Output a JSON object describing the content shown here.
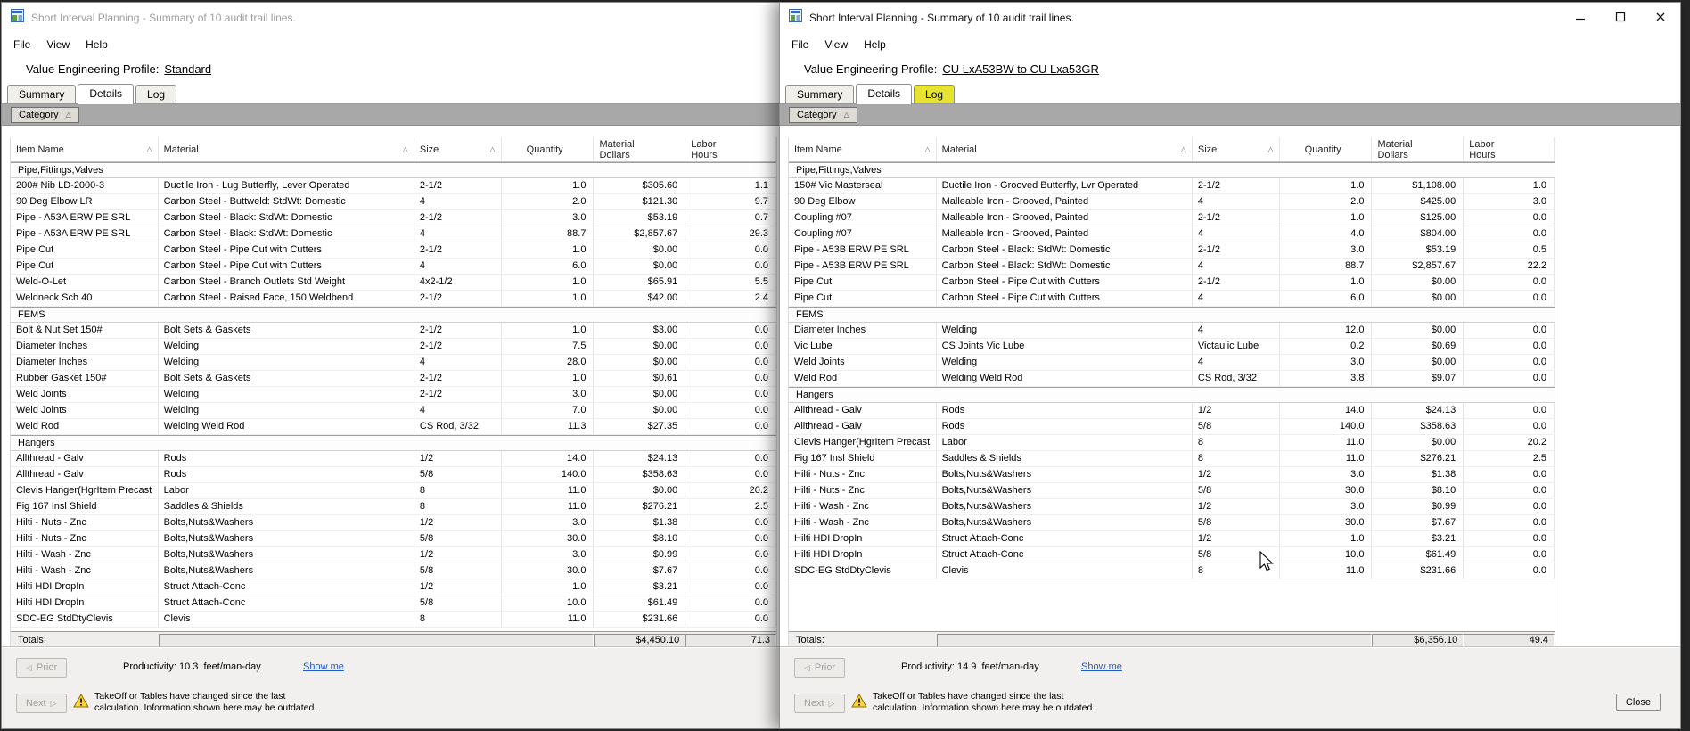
{
  "colors": {
    "log_tab_highlight": "#e6e332",
    "link_blue": "#2257c8",
    "warning_yellow": "#ffd23b"
  },
  "icons": {
    "sort_asc": "△",
    "prior_arrow": "◁",
    "next_arrow": "▷"
  },
  "columns": [
    {
      "label": "Item Name",
      "sortable": true
    },
    {
      "label": "Material",
      "sortable": true
    },
    {
      "label": "Size",
      "sortable": true
    },
    {
      "label": "Quantity",
      "sortable": false
    },
    {
      "label": "Material\nDollars",
      "sortable": false
    },
    {
      "label": "Labor\nHours",
      "sortable": false
    }
  ],
  "windows": [
    {
      "title": "Short Interval Planning - Summary of 10 audit trail lines.",
      "active": false,
      "menu": {
        "file": "File",
        "view": "View",
        "help": "Help"
      },
      "profile_label": "Value Engineering Profile:",
      "profile_value": "Standard",
      "tabs": {
        "summary": "Summary",
        "details": "Details",
        "log": "Log"
      },
      "group_by_label": "Category",
      "groups": [
        {
          "name": "Pipe,Fittings,Valves",
          "rows": [
            [
              "200# Nib LD-2000-3",
              "Ductile Iron - Lug Butterfly, Lever Operated",
              "2-1/2",
              "1.0",
              "$305.60",
              "1.1"
            ],
            [
              "90 Deg Elbow LR",
              "Carbon Steel - Buttweld: StdWt: Domestic",
              "4",
              "2.0",
              "$121.30",
              "9.7"
            ],
            [
              "Pipe - A53A ERW PE SRL",
              "Carbon Steel - Black: StdWt: Domestic",
              "2-1/2",
              "3.0",
              "$53.19",
              "0.7"
            ],
            [
              "Pipe - A53A ERW PE SRL",
              "Carbon Steel - Black: StdWt: Domestic",
              "4",
              "88.7",
              "$2,857.67",
              "29.3"
            ],
            [
              "Pipe Cut",
              "Carbon Steel - Pipe Cut with Cutters",
              "2-1/2",
              "1.0",
              "$0.00",
              "0.0"
            ],
            [
              "Pipe Cut",
              "Carbon Steel - Pipe Cut with Cutters",
              "4",
              "6.0",
              "$0.00",
              "0.0"
            ],
            [
              "Weld-O-Let",
              "Carbon Steel - Branch Outlets Std Weight",
              "4x2-1/2",
              "1.0",
              "$65.91",
              "5.5"
            ],
            [
              "Weldneck Sch 40",
              "Carbon Steel - Raised Face, 150 Weldbend",
              "2-1/2",
              "1.0",
              "$42.00",
              "2.4"
            ]
          ]
        },
        {
          "name": "FEMS",
          "rows": [
            [
              "Bolt & Nut Set 150#",
              "Bolt Sets & Gaskets",
              "2-1/2",
              "1.0",
              "$3.00",
              "0.0"
            ],
            [
              "Diameter Inches",
              "Welding",
              "2-1/2",
              "7.5",
              "$0.00",
              "0.0"
            ],
            [
              "Diameter Inches",
              "Welding",
              "4",
              "28.0",
              "$0.00",
              "0.0"
            ],
            [
              "Rubber Gasket 150#",
              "Bolt Sets & Gaskets",
              "2-1/2",
              "1.0",
              "$0.61",
              "0.0"
            ],
            [
              "Weld Joints",
              "Welding",
              "2-1/2",
              "3.0",
              "$0.00",
              "0.0"
            ],
            [
              "Weld Joints",
              "Welding",
              "4",
              "7.0",
              "$0.00",
              "0.0"
            ],
            [
              "Weld Rod",
              "Welding Weld Rod",
              "CS Rod, 3/32",
              "11.3",
              "$27.35",
              "0.0"
            ]
          ]
        },
        {
          "name": "Hangers",
          "rows": [
            [
              "Allthread - Galv",
              "Rods",
              "1/2",
              "14.0",
              "$24.13",
              "0.0"
            ],
            [
              "Allthread - Galv",
              "Rods",
              "5/8",
              "140.0",
              "$358.63",
              "0.0"
            ],
            [
              "Clevis Hanger(HgrItem Precast",
              "Labor",
              "8",
              "11.0",
              "$0.00",
              "20.2"
            ],
            [
              "Fig 167 Insl Shield",
              "Saddles & Shields",
              "8",
              "11.0",
              "$276.21",
              "2.5"
            ],
            [
              "Hilti - Nuts - Znc",
              "Bolts,Nuts&Washers",
              "1/2",
              "3.0",
              "$1.38",
              "0.0"
            ],
            [
              "Hilti - Nuts - Znc",
              "Bolts,Nuts&Washers",
              "5/8",
              "30.0",
              "$8.10",
              "0.0"
            ],
            [
              "Hilti - Wash - Znc",
              "Bolts,Nuts&Washers",
              "1/2",
              "3.0",
              "$0.99",
              "0.0"
            ],
            [
              "Hilti - Wash - Znc",
              "Bolts,Nuts&Washers",
              "5/8",
              "30.0",
              "$7.67",
              "0.0"
            ],
            [
              "Hilti HDI DropIn",
              "Struct Attach-Conc",
              "1/2",
              "1.0",
              "$3.21",
              "0.0"
            ],
            [
              "Hilti HDI DropIn",
              "Struct Attach-Conc",
              "5/8",
              "10.0",
              "$61.49",
              "0.0"
            ],
            [
              "SDC-EG StdDtyClevis",
              "Clevis",
              "8",
              "11.0",
              "$231.66",
              "0.0"
            ]
          ]
        }
      ],
      "totals": {
        "label": "Totals:",
        "material_dollars": "$4,450.10",
        "labor_hours": "71.3"
      },
      "footer": {
        "prior": "Prior",
        "next": "Next",
        "productivity": "Productivity: 10.3  feet/man-day",
        "show_me": "Show me",
        "warning_line1": "TakeOff or Tables have changed since the last",
        "warning_line2": "calculation. Information shown here may be outdated."
      }
    },
    {
      "title": "Short Interval Planning - Summary of 10 audit trail lines.",
      "active": true,
      "menu": {
        "file": "File",
        "view": "View",
        "help": "Help"
      },
      "profile_label": "Value Engineering Profile:",
      "profile_value": "CU LxA53BW to CU Lxa53GR",
      "tabs": {
        "summary": "Summary",
        "details": "Details",
        "log": "Log"
      },
      "group_by_label": "Category",
      "groups": [
        {
          "name": "Pipe,Fittings,Valves",
          "rows": [
            [
              "150# Vic Masterseal",
              "Ductile Iron - Grooved Butterfly, Lvr Operated",
              "2-1/2",
              "1.0",
              "$1,108.00",
              "1.0"
            ],
            [
              "90 Deg Elbow",
              "Malleable Iron - Grooved, Painted",
              "4",
              "2.0",
              "$425.00",
              "3.0"
            ],
            [
              "Coupling #07",
              "Malleable Iron - Grooved, Painted",
              "2-1/2",
              "1.0",
              "$125.00",
              "0.0"
            ],
            [
              "Coupling #07",
              "Malleable Iron - Grooved, Painted",
              "4",
              "4.0",
              "$804.00",
              "0.0"
            ],
            [
              "Pipe - A53B ERW PE SRL",
              "Carbon Steel - Black: StdWt: Domestic",
              "2-1/2",
              "3.0",
              "$53.19",
              "0.5"
            ],
            [
              "Pipe - A53B ERW PE SRL",
              "Carbon Steel - Black: StdWt: Domestic",
              "4",
              "88.7",
              "$2,857.67",
              "22.2"
            ],
            [
              "Pipe Cut",
              "Carbon Steel - Pipe Cut with Cutters",
              "2-1/2",
              "1.0",
              "$0.00",
              "0.0"
            ],
            [
              "Pipe Cut",
              "Carbon Steel - Pipe Cut with Cutters",
              "4",
              "6.0",
              "$0.00",
              "0.0"
            ]
          ]
        },
        {
          "name": "FEMS",
          "rows": [
            [
              "Diameter Inches",
              "Welding",
              "4",
              "12.0",
              "$0.00",
              "0.0"
            ],
            [
              "Vic Lube",
              "CS Joints Vic Lube",
              "Victaulic Lube",
              "0.2",
              "$0.69",
              "0.0"
            ],
            [
              "Weld Joints",
              "Welding",
              "4",
              "3.0",
              "$0.00",
              "0.0"
            ],
            [
              "Weld Rod",
              "Welding Weld Rod",
              "CS Rod, 3/32",
              "3.8",
              "$9.07",
              "0.0"
            ]
          ]
        },
        {
          "name": "Hangers",
          "rows": [
            [
              "Allthread - Galv",
              "Rods",
              "1/2",
              "14.0",
              "$24.13",
              "0.0"
            ],
            [
              "Allthread - Galv",
              "Rods",
              "5/8",
              "140.0",
              "$358.63",
              "0.0"
            ],
            [
              "Clevis Hanger(HgrItem Precast",
              "Labor",
              "8",
              "11.0",
              "$0.00",
              "20.2"
            ],
            [
              "Fig 167 Insl Shield",
              "Saddles & Shields",
              "8",
              "11.0",
              "$276.21",
              "2.5"
            ],
            [
              "Hilti - Nuts - Znc",
              "Bolts,Nuts&Washers",
              "1/2",
              "3.0",
              "$1.38",
              "0.0"
            ],
            [
              "Hilti - Nuts - Znc",
              "Bolts,Nuts&Washers",
              "5/8",
              "30.0",
              "$8.10",
              "0.0"
            ],
            [
              "Hilti - Wash - Znc",
              "Bolts,Nuts&Washers",
              "1/2",
              "3.0",
              "$0.99",
              "0.0"
            ],
            [
              "Hilti - Wash - Znc",
              "Bolts,Nuts&Washers",
              "5/8",
              "30.0",
              "$7.67",
              "0.0"
            ],
            [
              "Hilti HDI DropIn",
              "Struct Attach-Conc",
              "1/2",
              "1.0",
              "$3.21",
              "0.0"
            ],
            [
              "Hilti HDI DropIn",
              "Struct Attach-Conc",
              "5/8",
              "10.0",
              "$61.49",
              "0.0"
            ],
            [
              "SDC-EG StdDtyClevis",
              "Clevis",
              "8",
              "11.0",
              "$231.66",
              "0.0"
            ]
          ]
        }
      ],
      "totals": {
        "label": "Totals:",
        "material_dollars": "$6,356.10",
        "labor_hours": "49.4"
      },
      "footer": {
        "prior": "Prior",
        "next": "Next",
        "productivity": "Productivity: 14.9  feet/man-day",
        "show_me": "Show me",
        "warning_line1": "TakeOff or Tables have changed since the last",
        "warning_line2": "calculation. Information shown here may be outdated.",
        "close": "Close"
      }
    }
  ]
}
